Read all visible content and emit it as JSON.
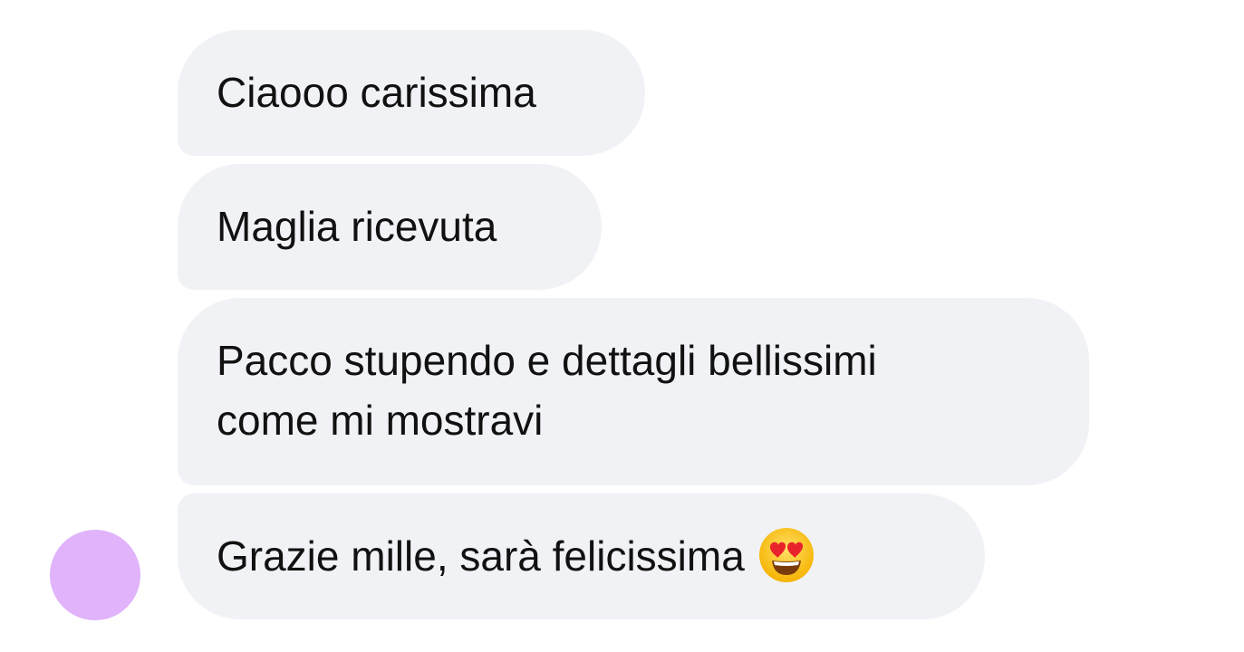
{
  "messages": [
    {
      "lines": [
        "Ciaooo carissima"
      ]
    },
    {
      "lines": [
        "Maglia ricevuta"
      ]
    },
    {
      "lines": [
        "Pacco stupendo e dettagli bellissimi",
        "come mi mostravi"
      ]
    },
    {
      "lines": [
        "Grazie mille, sarà felicissima"
      ],
      "emoji": "heart-eyes-emoji"
    }
  ],
  "colors": {
    "bubble_bg": "#f1f2f6",
    "text": "#111111",
    "avatar": "#e0b3fb"
  }
}
